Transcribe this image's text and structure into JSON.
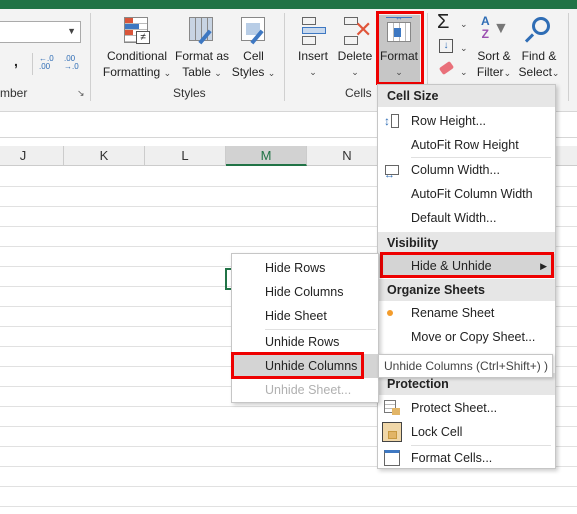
{
  "ribbon": {
    "number_group_label": "mber",
    "comma": ",",
    "inc_decimal": "←.0 .00",
    "dec_decimal": ".00 →.0",
    "styles_group_label": "Styles",
    "cells_group_label": "Cells",
    "buttons": {
      "conditional_formatting": [
        "Conditional",
        "Formatting"
      ],
      "format_as_table": [
        "Format as",
        "Table"
      ],
      "cell_styles": [
        "Cell",
        "Styles"
      ],
      "insert": "Insert",
      "delete": "Delete",
      "format": "Format",
      "sort_filter": [
        "Sort &",
        "Filter"
      ],
      "find_select": [
        "Find &",
        "Select"
      ]
    },
    "accent": "#217346"
  },
  "columns": [
    "J",
    "K",
    "L",
    "M",
    "N"
  ],
  "selected_column": "M",
  "format_menu": {
    "sections": [
      {
        "header": "Cell Size",
        "items": [
          "Row Height...",
          "AutoFit Row Height",
          "Column Width...",
          "AutoFit Column Width",
          "Default Width..."
        ]
      },
      {
        "header": "Visibility",
        "items": [
          "Hide & Unhide"
        ]
      },
      {
        "header": "Organize Sheets",
        "items": [
          "Rename Sheet",
          "Move or Copy Sheet..."
        ]
      },
      {
        "header": "Protection",
        "items": [
          "Protect Sheet...",
          "Lock Cell",
          "Format Cells..."
        ]
      }
    ]
  },
  "submenu": {
    "items": [
      "Hide Rows",
      "Hide Columns",
      "Hide Sheet",
      "Unhide Rows",
      "Unhide Columns",
      "Unhide Sheet..."
    ],
    "highlighted": "Unhide Columns",
    "disabled": "Unhide Sheet..."
  },
  "tooltip": "Unhide Columns (Ctrl+Shift+) )",
  "highlight_color": "#ee0000"
}
